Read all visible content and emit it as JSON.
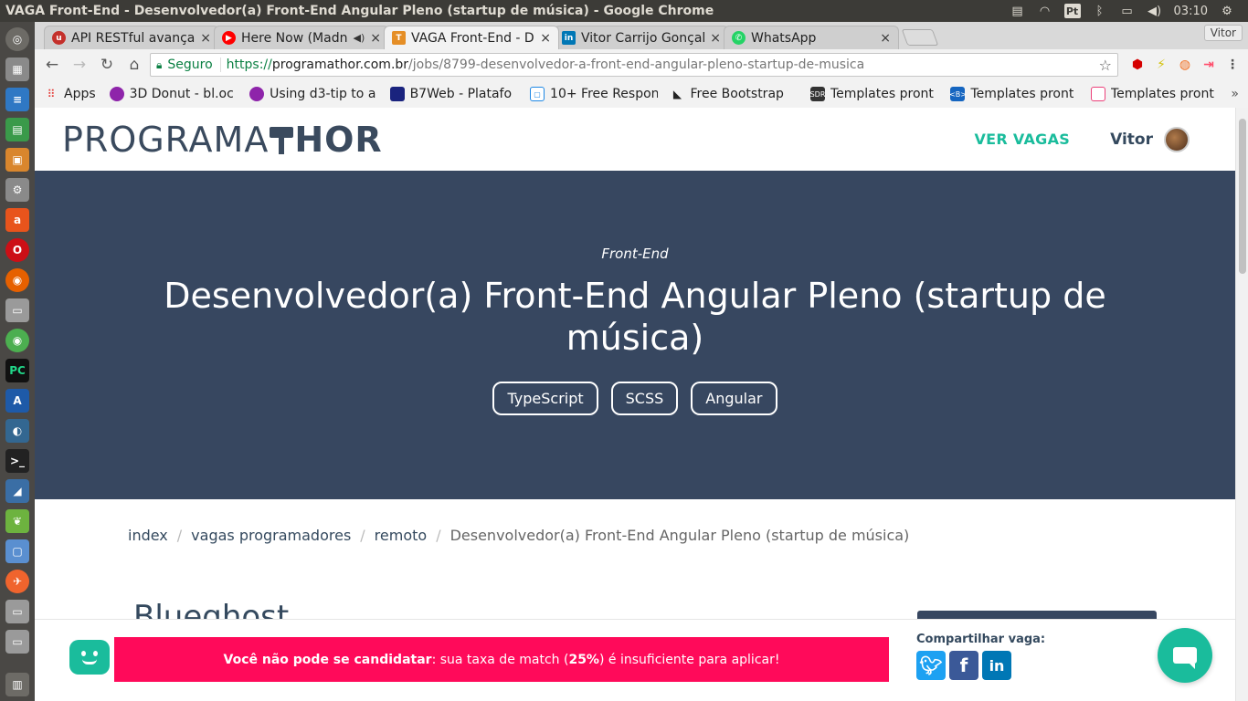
{
  "system": {
    "window_title": "VAGA Front-End - Desenvolvedor(a) Front-End Angular Pleno (startup de música) - Google Chrome",
    "lang": "Pt",
    "clock": "03:10"
  },
  "chrome": {
    "profile": "Vitor",
    "tabs": [
      {
        "label": "API RESTful avançada",
        "favicon_color": "#c4302b"
      },
      {
        "label": "Here Now (Madnes",
        "favicon_color": "#ff0000",
        "audio": "◀)"
      },
      {
        "label": "VAGA Front-End - D",
        "favicon_color": "#e58e26"
      },
      {
        "label": "Vitor Carrijo Gonçal",
        "favicon_color": "#0077b5"
      },
      {
        "label": "WhatsApp",
        "favicon_color": "#25d366"
      }
    ],
    "close_glyph": "×",
    "omnibox": {
      "secure_label": "Seguro",
      "scheme": "https://",
      "host": "programathor.com.br",
      "path": "/jobs/8799-desenvolvedor-a-front-end-angular-pleno-startup-de-musica"
    },
    "bookmarks": [
      {
        "label": "Apps",
        "color": "#e53935"
      },
      {
        "label": "3D Donut - bl.oc",
        "color": "#8e24aa"
      },
      {
        "label": "Using d3-tip to a",
        "color": "#8e24aa"
      },
      {
        "label": "B7Web - Platafo",
        "color": "#1a237e"
      },
      {
        "label": "10+ Free Respon",
        "color": "#1e88e5"
      },
      {
        "label": "Free Bootstrap",
        "color": "#222222"
      },
      {
        "label": "Templates pront",
        "color": "#333333"
      },
      {
        "label": "Templates pront",
        "color": "#1565c0"
      },
      {
        "label": "Templates pront",
        "color": "#ec407a"
      }
    ],
    "bookmarks_more": "»"
  },
  "site": {
    "logo_left": "PROGRAMA",
    "logo_right": "HOR",
    "nav_jobs": "VER VAGAS",
    "user_name": "Vitor"
  },
  "job": {
    "category": "Front-End",
    "title": "Desenvolvedor(a) Front-End Angular Pleno (startup de música)",
    "tags": [
      "TypeScript",
      "SCSS",
      "Angular"
    ],
    "breadcrumb": [
      "index",
      "vagas programadores",
      "remoto",
      "Desenvolvedor(a) Front-End Angular Pleno (startup de música)"
    ],
    "company": "Blueghost"
  },
  "alert": {
    "bold_part": "Você não pode se candidatar",
    "text_before_pct": ": sua taxa de match (",
    "match_pct": "25%",
    "text_after_pct": ") é insuficiente para aplicar!"
  },
  "share": {
    "label": "Compartilhar vaga:"
  },
  "colors": {
    "accent": "#1abc9c",
    "hero_bg": "#374760",
    "alert_bg": "#ff0a5a"
  }
}
